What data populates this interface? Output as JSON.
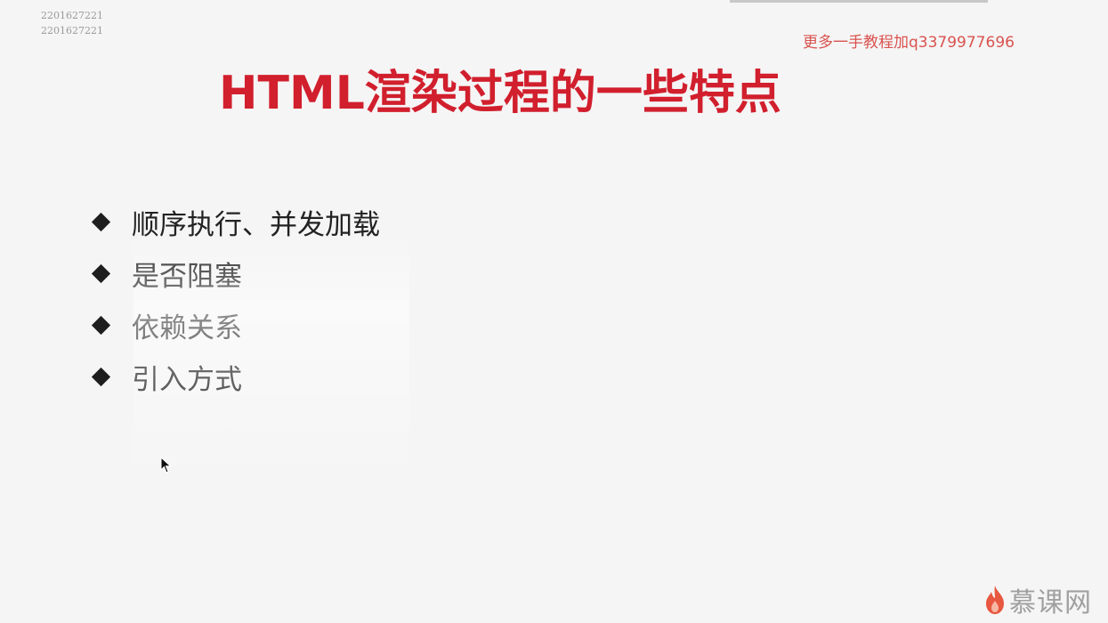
{
  "watermark": {
    "ids": [
      "2201627221",
      "2201627221"
    ],
    "promo": "更多一手教程加q3379977696"
  },
  "slide": {
    "title": "HTML渲染过程的一些特点",
    "bullets": [
      {
        "text": "顺序执行、并发加载"
      },
      {
        "text": "是否阻塞"
      },
      {
        "text": "依赖关系"
      },
      {
        "text": "引入方式"
      }
    ]
  },
  "brand": {
    "logo_text": "慕课网",
    "accent": "#e8573f"
  },
  "colors": {
    "title": "#d11f2d",
    "promo": "#d9534f",
    "bullet": "#1e1e1e"
  }
}
